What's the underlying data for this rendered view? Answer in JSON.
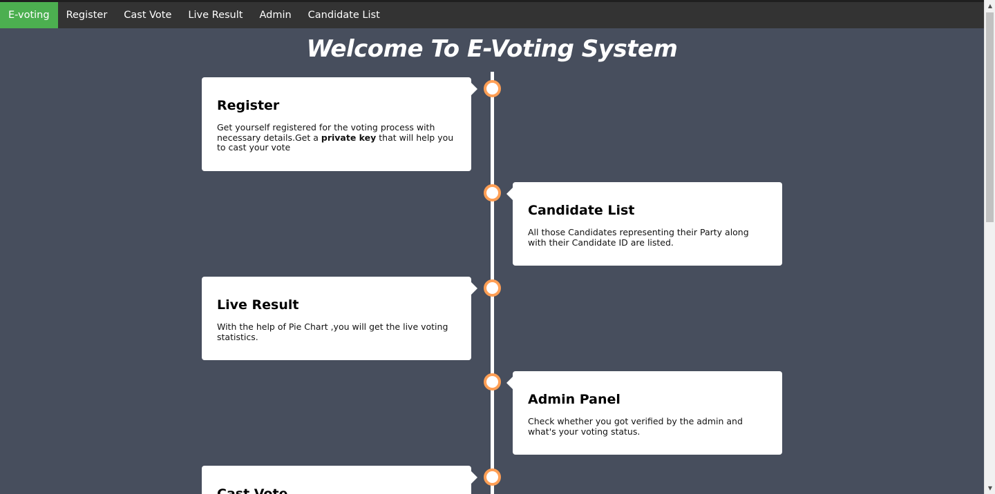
{
  "nav": {
    "items": [
      {
        "label": "E-voting",
        "active": true
      },
      {
        "label": "Register",
        "active": false
      },
      {
        "label": "Cast Vote",
        "active": false
      },
      {
        "label": "Live Result",
        "active": false
      },
      {
        "label": "Admin",
        "active": false
      },
      {
        "label": "Candidate List",
        "active": false
      }
    ]
  },
  "page": {
    "title": "Welcome To E-Voting System"
  },
  "timeline": [
    {
      "title": "Register",
      "text_before": "Get yourself registered for the voting process with necessary details.Get a ",
      "text_bold": "private key",
      "text_after": " that will help you to cast your vote"
    },
    {
      "title": "Candidate List",
      "text": "All those Candidates representing their Party along with their Candidate ID are listed."
    },
    {
      "title": "Live Result",
      "text": "With the help of Pie Chart ,you will get the live voting statistics."
    },
    {
      "title": "Admin Panel",
      "text": "Check whether you got verified by the admin and what's your voting status."
    },
    {
      "title": "Cast Vote"
    }
  ],
  "colors": {
    "background": "#474e5d",
    "navbar": "#333333",
    "active_nav": "#4caf50",
    "timeline_dot_border": "#ff9f55"
  }
}
